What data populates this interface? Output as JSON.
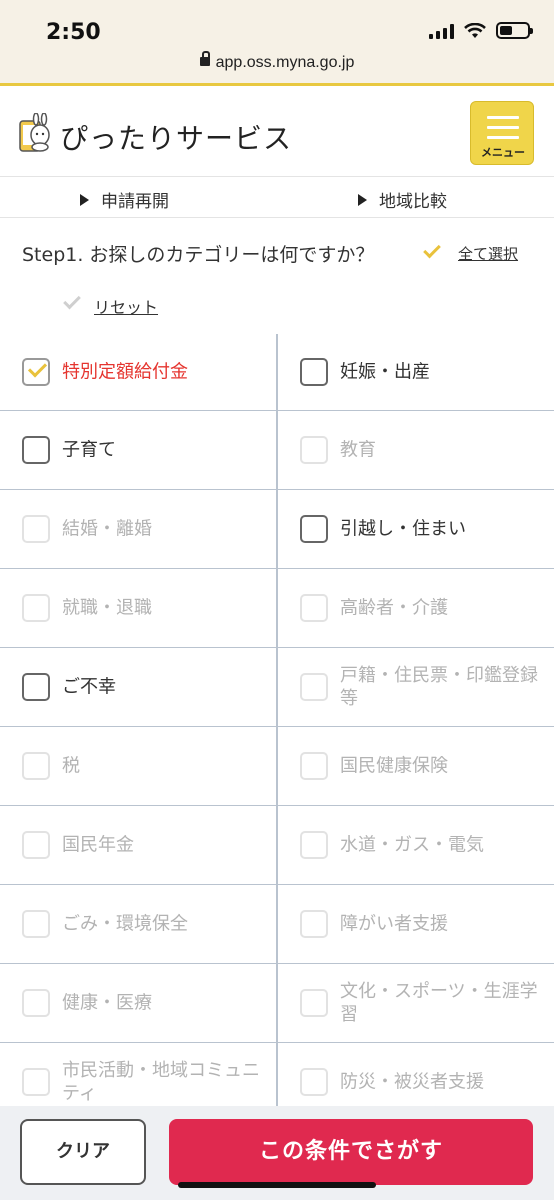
{
  "status_bar": {
    "time": "2:50"
  },
  "browser": {
    "url": "app.oss.myna.go.jp"
  },
  "header": {
    "brand": "ぴったりサービス",
    "menu_label": "メニュー"
  },
  "subnav": {
    "resume": "申請再開",
    "compare": "地域比較"
  },
  "question": {
    "text": "Step1. お探しのカテゴリーは何ですか？",
    "select_all": "全て選択",
    "reset": "リセット"
  },
  "categories": [
    {
      "label": "特別定額給付金",
      "state": "selected"
    },
    {
      "label": "妊娠・出産",
      "state": "enabled"
    },
    {
      "label": "子育て",
      "state": "enabled"
    },
    {
      "label": "教育",
      "state": "disabled"
    },
    {
      "label": "結婚・離婚",
      "state": "disabled"
    },
    {
      "label": "引越し・住まい",
      "state": "enabled"
    },
    {
      "label": "就職・退職",
      "state": "disabled"
    },
    {
      "label": "高齢者・介護",
      "state": "disabled"
    },
    {
      "label": "ご不幸",
      "state": "enabled"
    },
    {
      "label": "戸籍・住民票・印鑑登録等",
      "state": "disabled"
    },
    {
      "label": "税",
      "state": "disabled"
    },
    {
      "label": "国民健康保険",
      "state": "disabled"
    },
    {
      "label": "国民年金",
      "state": "disabled"
    },
    {
      "label": "水道・ガス・電気",
      "state": "disabled"
    },
    {
      "label": "ごみ・環境保全",
      "state": "disabled"
    },
    {
      "label": "障がい者支援",
      "state": "disabled"
    },
    {
      "label": "健康・医療",
      "state": "disabled"
    },
    {
      "label": "文化・スポーツ・生涯学習",
      "state": "disabled"
    },
    {
      "label": "市民活動・地域コミュニティ",
      "state": "disabled"
    },
    {
      "label": "防災・被災者支援",
      "state": "disabled"
    }
  ],
  "footer": {
    "clear": "クリア",
    "search": "この条件でさがす"
  },
  "colors": {
    "accent_yellow": "#f0d54a",
    "search_red": "#e0294f",
    "selected_red": "#e5352f"
  }
}
